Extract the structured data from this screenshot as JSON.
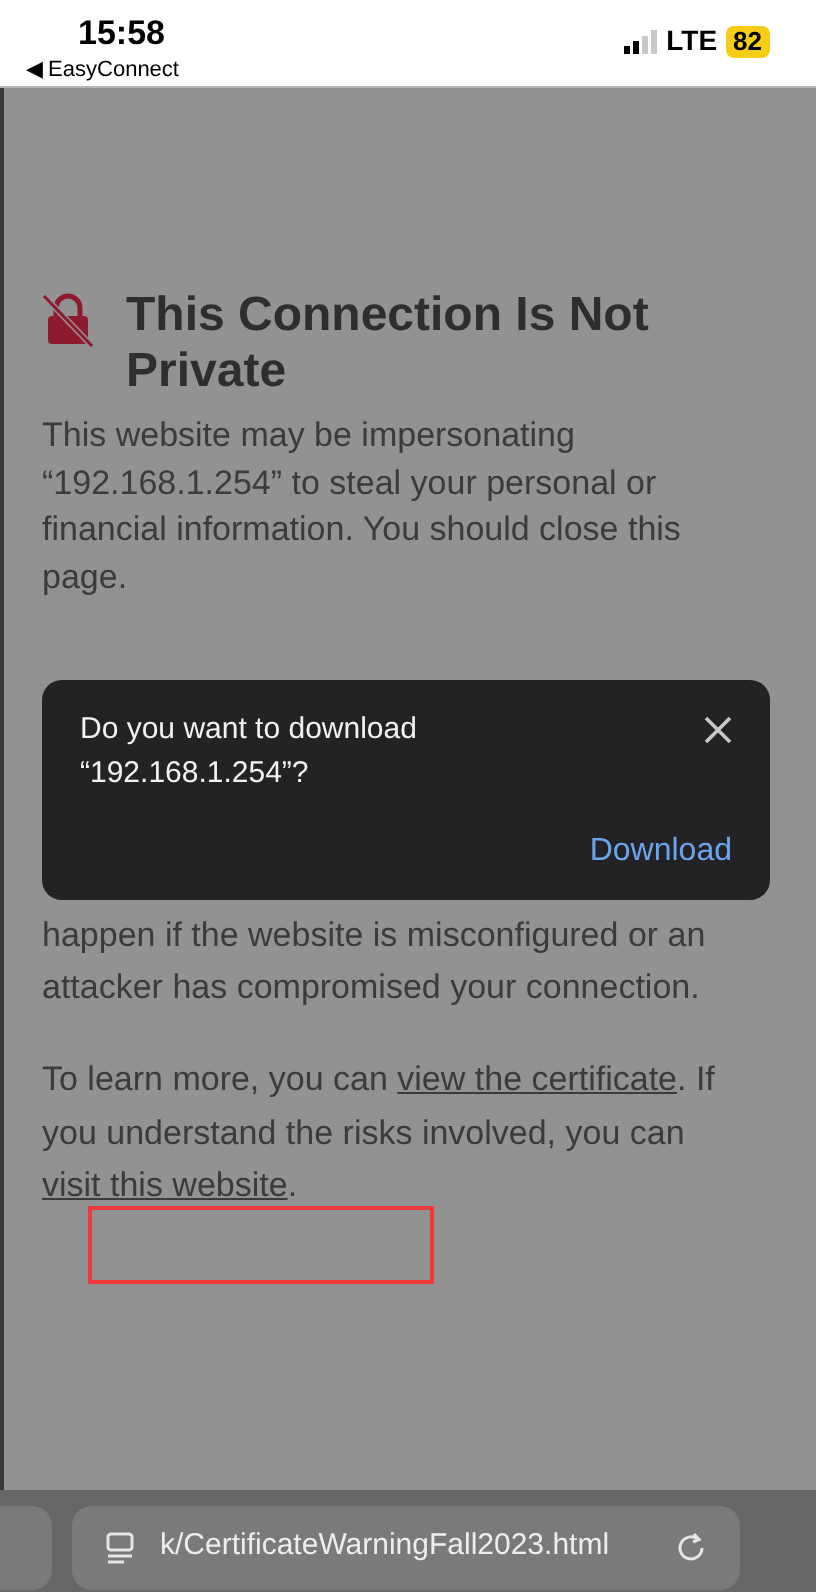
{
  "status_bar": {
    "time": "15:58",
    "back_app": "◀ EasyConnect",
    "network": "LTE",
    "battery": "82"
  },
  "warning": {
    "title": "This Connection Is Not Private",
    "body": "This website may be impersonating “192.168.1.254” to steal your personal or financial information. You should close this page.",
    "details_visible": "happen if the website is misconfigured or an attacker has compromised your connection.",
    "learn_more": {
      "before": "To learn more, you can ",
      "link_1": "view the certificate",
      "middle": ". If you understand the risks involved, you can ",
      "link_2": "visit this website",
      "after": "."
    }
  },
  "download_prompt": {
    "message": "Do you want to download “192.168.1.254”?",
    "action": "Download"
  },
  "address_bar": {
    "url": "k/CertificateWarningFall2023.html"
  }
}
